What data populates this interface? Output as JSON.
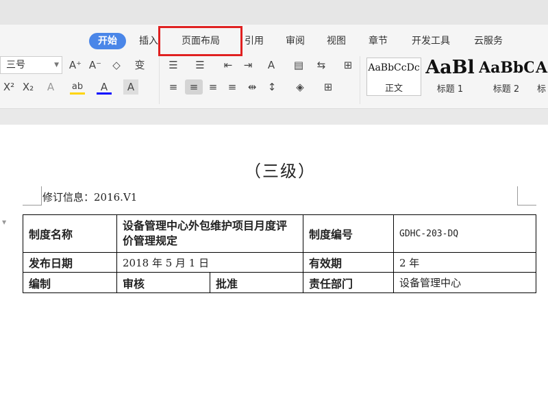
{
  "ribbon": {
    "tabs": [
      {
        "label": "开始",
        "active": true
      },
      {
        "label": "插入"
      },
      {
        "label": "页面布局",
        "highlighted": true
      },
      {
        "label": "引用"
      },
      {
        "label": "审阅"
      },
      {
        "label": "视图"
      },
      {
        "label": "章节"
      },
      {
        "label": "开发工具"
      },
      {
        "label": "云服务"
      }
    ],
    "font_size": "三号",
    "tool_glyphs": {
      "grow_font": "A⁺",
      "shrink_font": "A⁻",
      "eraser": "◇",
      "phonetic": "变",
      "superscript": "X²",
      "subscript": "X₂",
      "text_effect": "A",
      "highlight": "ab",
      "font_color": "A",
      "char_shading": "A"
    },
    "styles": [
      {
        "sample": "AaBbCcDc",
        "label": "正文",
        "selected": true
      },
      {
        "sample": "AaBl",
        "label": "标题 1"
      },
      {
        "sample": "AaBbC",
        "label": "标题 2"
      },
      {
        "sample": "A",
        "label": "标"
      }
    ],
    "colors": {
      "active_tab": "#4a86e8",
      "highlight_box": "#e02020",
      "font_color_bar": "#0000ff",
      "highlight_color_bar": "#ffd400"
    }
  },
  "document": {
    "title": "（三级）",
    "revision": "修订信息：2016.V1",
    "table": {
      "row1": {
        "label1": "制度名称",
        "value1": "设备管理中心外包维护项目月度评价管理规定",
        "label2": "制度编号",
        "value2": "GDHC-203-DQ"
      },
      "row2": {
        "label1": "发布日期",
        "value1": "2018 年 5 月 1 日",
        "label2": "有效期",
        "value2": "2 年"
      },
      "row3": {
        "label1": "编制",
        "label_review": "审核",
        "label_approve": "批准",
        "label2": "责任部门",
        "value2": "设备管理中心"
      }
    }
  }
}
